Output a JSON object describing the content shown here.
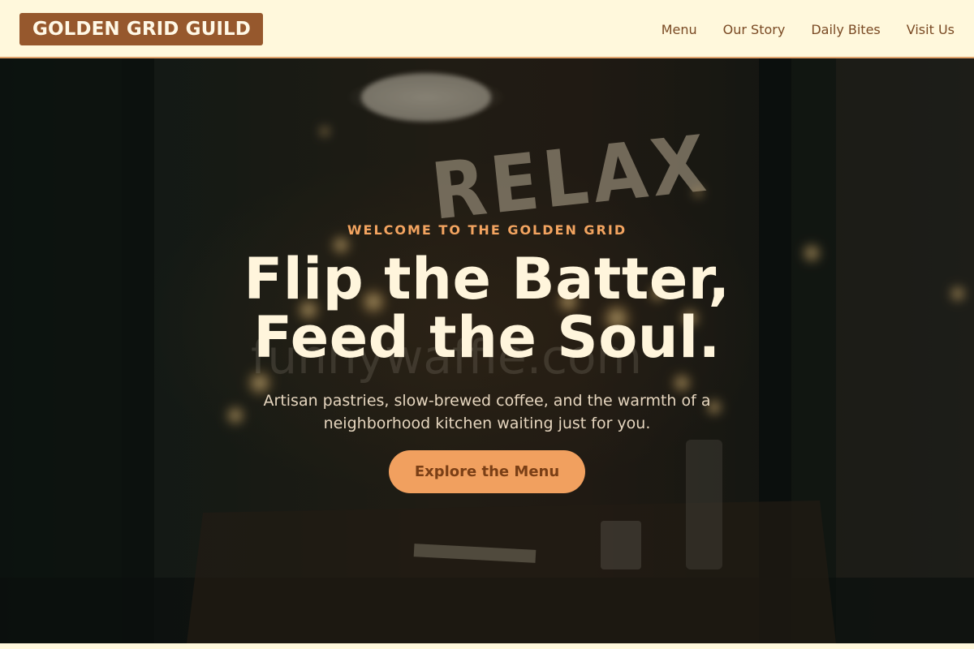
{
  "header": {
    "logo_text": "GOLDEN GRID GUILD",
    "nav": [
      {
        "label": "Menu"
      },
      {
        "label": "Our Story"
      },
      {
        "label": "Daily Bites"
      },
      {
        "label": "Visit Us"
      }
    ]
  },
  "hero": {
    "eyebrow": "WELCOME TO THE GOLDEN GRID",
    "headline_line1": "Flip the Batter,",
    "headline_line2": "Feed the Soul.",
    "subtitle": "Artisan pastries, slow-brewed coffee, and the warmth of a neighborhood kitchen waiting just for you.",
    "cta_label": "Explore the Menu",
    "photo_sign_text": "RELAX",
    "photo_watermark": "funnywaffle.com"
  },
  "colors": {
    "header_bg": "#fff8dc",
    "logo_bg": "#96582d",
    "nav_text": "#7a4a24",
    "accent": "#f1a05f",
    "eyebrow": "#f3a460",
    "headline": "#fff5dc"
  }
}
